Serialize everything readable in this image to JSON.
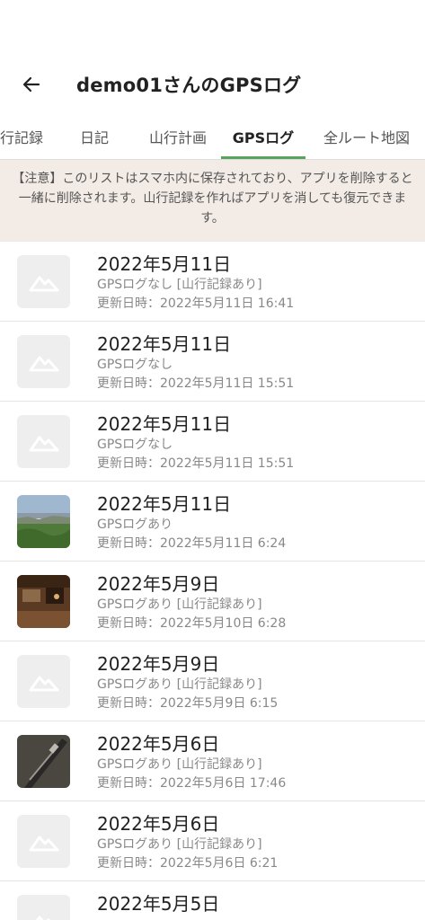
{
  "app_bar": {
    "title": "demo01さんのGPSログ"
  },
  "tabs": [
    {
      "label": "行記録"
    },
    {
      "label": "日記"
    },
    {
      "label": "山行計画"
    },
    {
      "label": "GPSログ",
      "active": true
    },
    {
      "label": "全ルート地図"
    }
  ],
  "notice": {
    "text": "【注意】このリストはスマホ内に保存されており、アプリを削除すると一緒に削除されます。山行記録を作ればアプリを消しても復元できます。"
  },
  "logs": [
    {
      "date": "2022年5月11日",
      "status": "GPSログなし [山行記録あり]",
      "updated": "更新日時：2022年5月11日 16:41",
      "thumbnail": "placeholder-mountain"
    },
    {
      "date": "2022年5月11日",
      "status": "GPSログなし",
      "updated": "更新日時：2022年5月11日 15:51",
      "thumbnail": "placeholder-mountain"
    },
    {
      "date": "2022年5月11日",
      "status": "GPSログなし",
      "updated": "更新日時：2022年5月11日 15:51",
      "thumbnail": "placeholder-mountain"
    },
    {
      "date": "2022年5月11日",
      "status": "GPSログあり",
      "updated": "更新日時：2022年5月11日 6:24",
      "thumbnail": "photo-landscape"
    },
    {
      "date": "2022年5月9日",
      "status": "GPSログあり [山行記録あり]",
      "updated": "更新日時：2022年5月10日 6:28",
      "thumbnail": "photo-indoor"
    },
    {
      "date": "2022年5月9日",
      "status": "GPSログあり [山行記録あり]",
      "updated": "更新日時：2022年5月9日 6:15",
      "thumbnail": "placeholder-mountain"
    },
    {
      "date": "2022年5月6日",
      "status": "GPSログあり [山行記録あり]",
      "updated": "更新日時：2022年5月6日 17:46",
      "thumbnail": "photo-object"
    },
    {
      "date": "2022年5月6日",
      "status": "GPSログあり [山行記録あり]",
      "updated": "更新日時：2022年5月6日 6:21",
      "thumbnail": "placeholder-mountain"
    },
    {
      "date": "2022年5月5日",
      "thumbnail": "placeholder-mountain"
    }
  ],
  "colors": {
    "tab_indicator": "#5aa35e",
    "notice_background": "#f3ece6",
    "placeholder_background": "#eeeeee"
  }
}
